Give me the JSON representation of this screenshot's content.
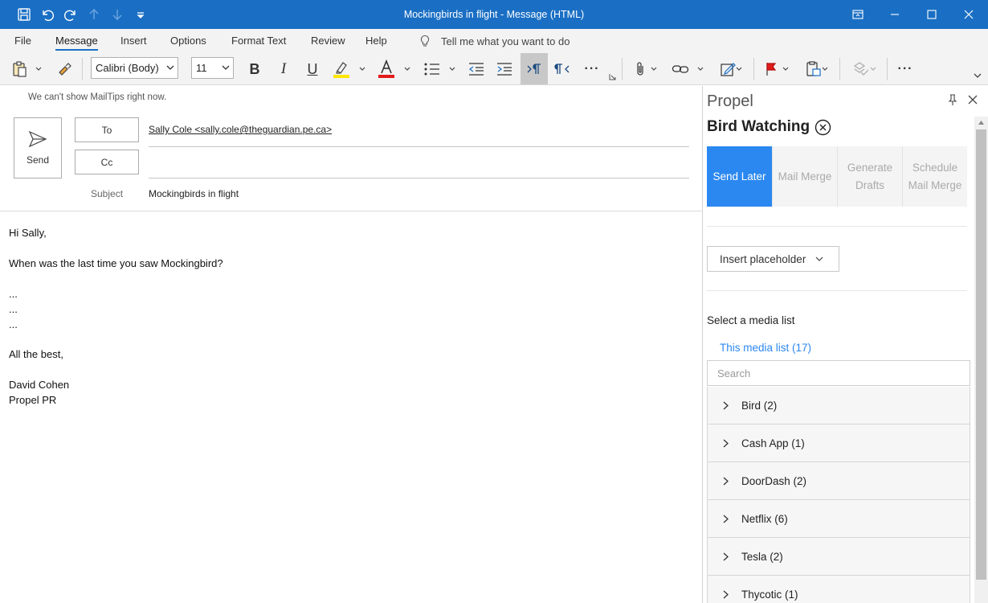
{
  "window": {
    "title": "Mockingbirds in flight  -  Message (HTML)"
  },
  "quick_access": [
    "save-icon",
    "undo-icon",
    "redo-icon",
    "arrow-up-icon",
    "arrow-down-icon",
    "customize-icon"
  ],
  "menu": {
    "items": [
      {
        "label": "File"
      },
      {
        "label": "Message",
        "active": true
      },
      {
        "label": "Insert"
      },
      {
        "label": "Options"
      },
      {
        "label": "Format Text"
      },
      {
        "label": "Review"
      },
      {
        "label": "Help"
      }
    ],
    "tell_me": "Tell me what you want to do"
  },
  "ribbon": {
    "font_name": "Calibri (Body)",
    "font_size": "11",
    "bold": "B",
    "italic": "I",
    "underline": "U",
    "highlight_color": "#ffe600",
    "font_color": "#e31b1b",
    "more": "···"
  },
  "compose": {
    "mailtips": "We can't show MailTips right now.",
    "send_label": "Send",
    "to_label": "To",
    "cc_label": "Cc",
    "to_value": "Sally Cole <sally.cole@theguardian.pe.ca>",
    "subject_label": "Subject",
    "subject_value": "Mockingbirds in flight",
    "body": [
      "Hi Sally,",
      "When was the last time you saw Mockingbird?",
      "...",
      "...",
      "...",
      "All the best,",
      "David Cohen",
      "Propel PR"
    ]
  },
  "pane": {
    "title": "Propel",
    "campaign": "Bird Watching",
    "tabs": [
      {
        "label": "Send Later",
        "active": true
      },
      {
        "label": "Mail Merge"
      },
      {
        "label": "Generate Drafts"
      },
      {
        "label": "Schedule Mail Merge"
      }
    ],
    "insert_placeholder": "Insert placeholder",
    "select_media_label": "Select a media list",
    "media_link": "This media list (17)",
    "search_placeholder": "Search",
    "lists": [
      {
        "label": "Bird (2)"
      },
      {
        "label": "Cash App (1)"
      },
      {
        "label": "DoorDash (2)"
      },
      {
        "label": "Netflix (6)"
      },
      {
        "label": "Tesla (2)"
      },
      {
        "label": "Thycotic (1)"
      }
    ]
  },
  "colors": {
    "titlebar": "#1a6fc4",
    "accent": "#2b88f0"
  }
}
